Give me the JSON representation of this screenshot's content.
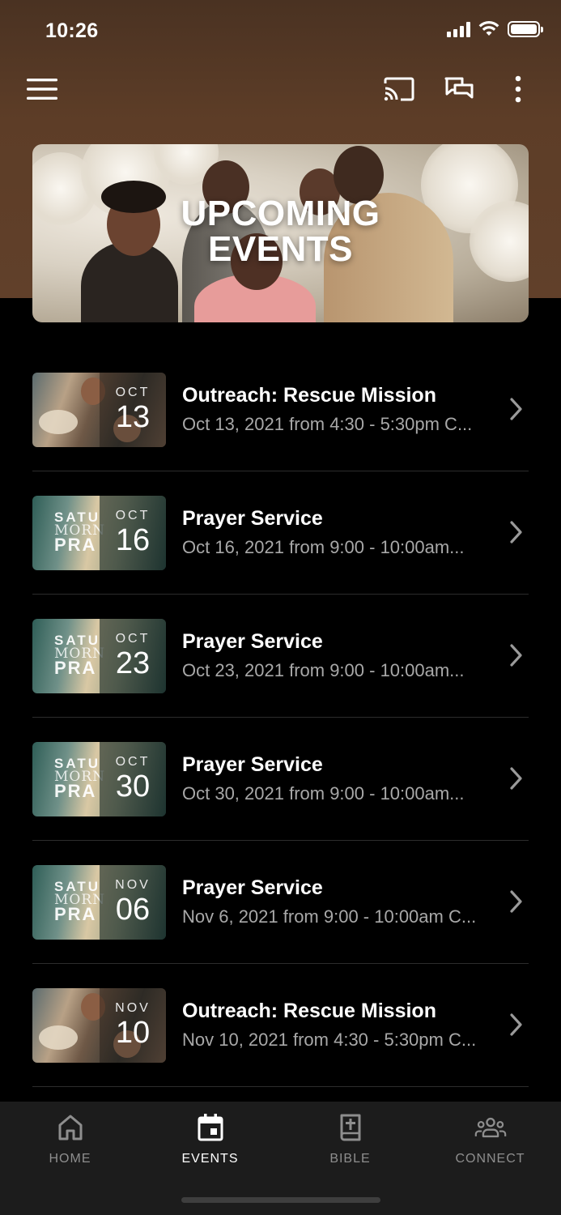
{
  "status_bar": {
    "time": "10:26"
  },
  "hero": {
    "title_line1": "UPCOMING",
    "title_line2": "EVENTS"
  },
  "events": [
    {
      "title": "Outreach: Rescue Mission",
      "subtitle": "Oct 13, 2021 from 4:30 - 5:30pm C...",
      "month": "OCT",
      "day": "13",
      "thumb": "outreach"
    },
    {
      "title": "Prayer Service",
      "subtitle": "Oct 16, 2021 from 9:00 - 10:00am...",
      "month": "OCT",
      "day": "16",
      "thumb": "prayer",
      "thumb_text": [
        "SATU",
        "MORN",
        "PRA"
      ]
    },
    {
      "title": "Prayer Service",
      "subtitle": "Oct 23, 2021 from 9:00 - 10:00am...",
      "month": "OCT",
      "day": "23",
      "thumb": "prayer",
      "thumb_text": [
        "SATU",
        "MORN",
        "PRA"
      ]
    },
    {
      "title": "Prayer Service",
      "subtitle": "Oct 30, 2021 from 9:00 - 10:00am...",
      "month": "OCT",
      "day": "30",
      "thumb": "prayer",
      "thumb_text": [
        "SATU",
        "MORN",
        "PRA"
      ]
    },
    {
      "title": "Prayer Service",
      "subtitle": "Nov 6, 2021 from 9:00 - 10:00am C...",
      "month": "NOV",
      "day": "06",
      "thumb": "prayer",
      "thumb_text": [
        "SATU",
        "MORN",
        "PRA"
      ]
    },
    {
      "title": "Outreach: Rescue Mission",
      "subtitle": "Nov 10, 2021 from 4:30 - 5:30pm C...",
      "month": "NOV",
      "day": "10",
      "thumb": "outreach"
    }
  ],
  "nav": {
    "home": "HOME",
    "events": "EVENTS",
    "bible": "BIBLE",
    "connect": "CONNECT"
  },
  "icons": {
    "menu": "menu-icon",
    "cast": "cast-icon",
    "chat": "chat-icon",
    "more": "more-vertical-icon",
    "home": "home-icon",
    "events": "calendar-icon",
    "bible": "bible-icon",
    "connect": "people-icon",
    "chevron": "chevron-right-icon"
  },
  "colors": {
    "header_brown": "#5d3d27",
    "background": "#000000",
    "nav_bg": "#1c1c1c",
    "muted_text": "#a8a8a8"
  }
}
